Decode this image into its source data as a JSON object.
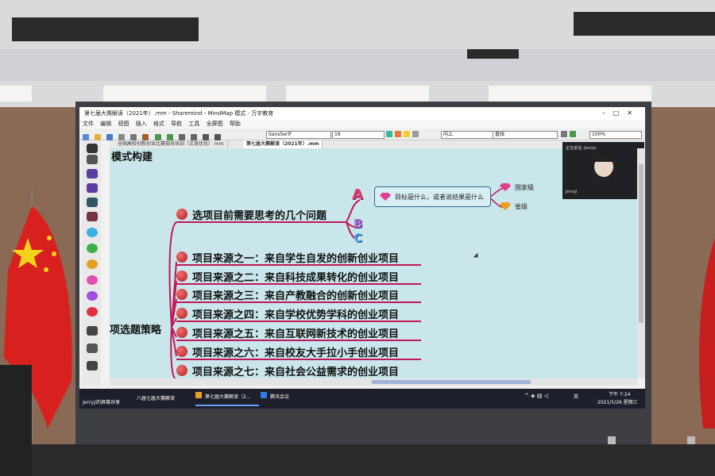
{
  "window": {
    "title": "第七届大赛解读（2021年）.mm - Sharemind - MindMap 模式 - 万宇教育"
  },
  "menu": [
    "文件",
    "编辑",
    "视图",
    "插入",
    "格式",
    "导航",
    "工具",
    "全屏图",
    "帮助"
  ],
  "toolbar": {
    "font_family": "SansSerif",
    "font_size": "16",
    "position": "向上",
    "line_style": "直线",
    "zoom": "100%"
  },
  "tabs": [
    "全国高校创新创业比赛指导培训（文旅优化）.mm",
    "第七届大赛解读（2021年）.mm"
  ],
  "map": {
    "top_partial": "模式构建",
    "left_partial": "项选题策略",
    "first_node": "选项目前需要思考的几个问题",
    "letters": [
      "A",
      "B",
      "C"
    ],
    "goal_box": "目标是什么，或者说结果是什么",
    "levels": [
      "国家级",
      "省级"
    ],
    "sources": [
      "项目来源之一：来自学生自发的创新创业项目",
      "项目来源之二：来自科技成果转化的创业项目",
      "项目来源之三：来自产教融合的创新创业项目",
      "项目来源之四：来自学校优势学科的创业项目",
      "项目来源之五：来自互联网新技术的创业项目",
      "项目来源之六：来自校友大手拉小手创业项目",
      "项目来源之七：来自社会公益需求的创业项目"
    ]
  },
  "meeting": {
    "speaking_label": "正在讲话: Jerryjc",
    "user_label": "Jerryji"
  },
  "taskbar": {
    "share_label": "Jerryji的屏幕共享",
    "app1": "八届七届大赛解读",
    "app2": "第七届大赛解读（2...",
    "app3": "腾讯会议",
    "time": "下午 7:24",
    "date": "2021/5/26 星期三",
    "ime": "英"
  },
  "colors": {
    "canvas": "#c9e6ea",
    "branch": "#c0185a",
    "taskbar": "#1d1f2b",
    "flag": "#d8201f"
  }
}
